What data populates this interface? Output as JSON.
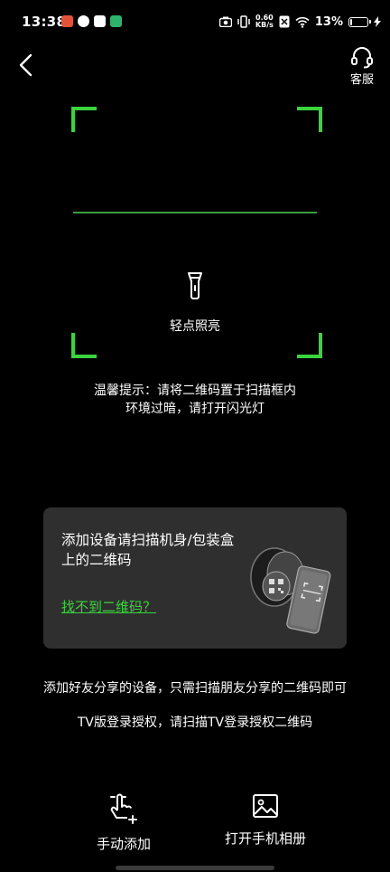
{
  "status_bar": {
    "time": "13:38",
    "net_speed_value": "0.60",
    "net_speed_unit": "KB/s",
    "battery_percent": "13%",
    "battery_level": 0.13
  },
  "header": {
    "service_label": "客服"
  },
  "scanner": {
    "torch_label": "轻点照亮",
    "hint_line1": "温馨提示：请将二维码置于扫描框内",
    "hint_line2": "环境过暗，请打开闪光灯"
  },
  "card": {
    "text": "添加设备请扫描机身/包装盒上的二维码",
    "link": "找不到二维码？"
  },
  "info": {
    "line1": "添加好友分享的设备，只需扫描朋友分享的二维码即可",
    "line2": "TV版登录授权，请扫描TV登录授权二维码"
  },
  "actions": {
    "manual_add": "手动添加",
    "open_album": "打开手机相册"
  },
  "colors": {
    "accent": "#3ad43c",
    "card_bg": "#2f2f2f",
    "background": "#000000"
  },
  "icons": {
    "back": "back-chevron-icon",
    "service": "headset-icon",
    "torch": "flashlight-icon",
    "manual": "hand-tap-plus-icon",
    "album": "image-icon"
  }
}
